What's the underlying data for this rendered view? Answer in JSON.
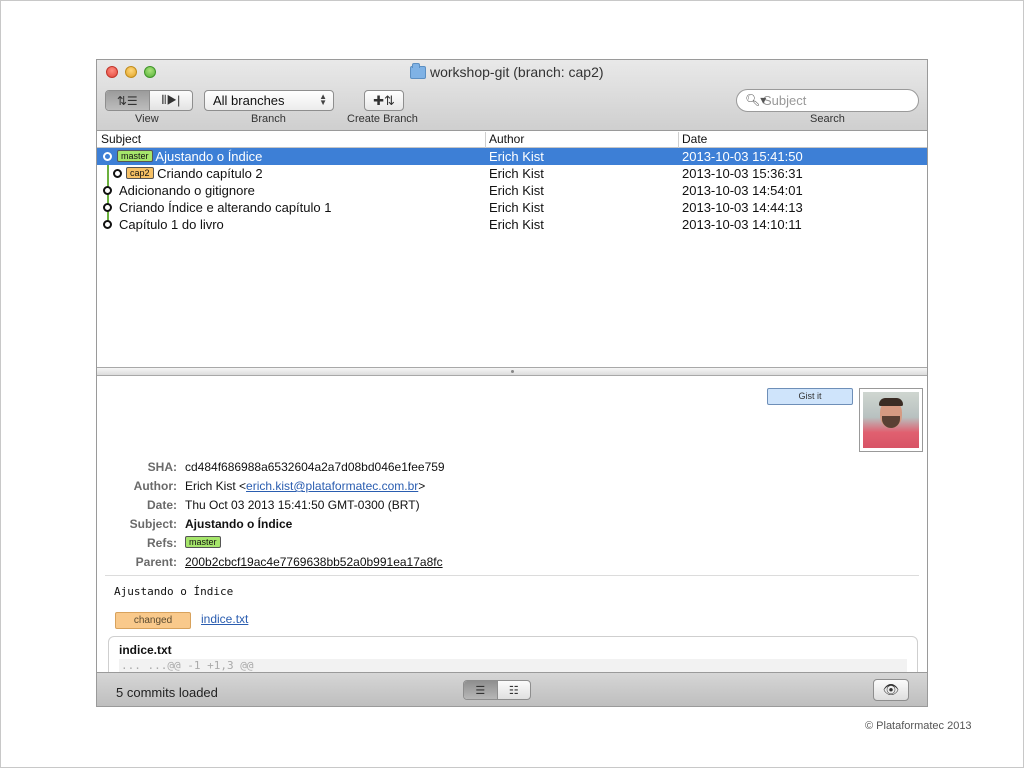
{
  "window": {
    "title": "workshop-git (branch: cap2)"
  },
  "toolbar": {
    "view_label": "View",
    "branch_label": "Branch",
    "branch_value": "All branches",
    "create_branch_label": "Create Branch",
    "search_label": "Search",
    "search_placeholder": "Subject"
  },
  "table": {
    "headers": {
      "subject": "Subject",
      "author": "Author",
      "date": "Date"
    },
    "rows": [
      {
        "ref": "master",
        "subject": "Ajustando o Índice",
        "author": "Erich Kist",
        "date": "2013-10-03 15:41:50",
        "selected": true
      },
      {
        "ref": "cap2",
        "subject": "Criando capítulo 2",
        "author": "Erich Kist",
        "date": "2013-10-03 15:36:31"
      },
      {
        "ref": "",
        "subject": "Adicionando o gitignore",
        "author": "Erich Kist",
        "date": "2013-10-03 14:54:01"
      },
      {
        "ref": "",
        "subject": "Criando Índice e alterando capítulo 1",
        "author": "Erich Kist",
        "date": "2013-10-03 14:44:13"
      },
      {
        "ref": "",
        "subject": "Capítulo 1 do livro",
        "author": "Erich Kist",
        "date": "2013-10-03 14:10:11"
      }
    ]
  },
  "detail": {
    "gist_button": "Gist it",
    "sha_label": "SHA:",
    "sha": "cd484f686988a6532604a2a7d08bd046e1fee759",
    "author_label": "Author:",
    "author_name": "Erich Kist <",
    "author_email": "erich.kist@plataformatec.com.br",
    "author_close": ">",
    "date_label": "Date:",
    "date": "Thu Oct 03 2013 15:41:50 GMT-0300 (BRT)",
    "subject_label": "Subject:",
    "subject": "Ajustando o Índice",
    "refs_label": "Refs:",
    "refs_value": "master",
    "parent_label": "Parent:",
    "parent": "200b2cbcf19ac4e7769638bb52a0b991ea17a8fc",
    "message": "Ajustando o Índice",
    "change_status": "changed",
    "file": "indice.txt",
    "diff_file_title": "indice.txt",
    "diff_hunk": "... ...@@ -1 +1,3 @@"
  },
  "status": {
    "text": "5 commits loaded"
  },
  "footer": {
    "copyright": "© Plataformatec 2013"
  },
  "colors": {
    "selection": "#3d7fd6",
    "master_ref": "#a6e66b",
    "cap2_ref": "#f7c165",
    "graph_line": "#6bb03d"
  }
}
